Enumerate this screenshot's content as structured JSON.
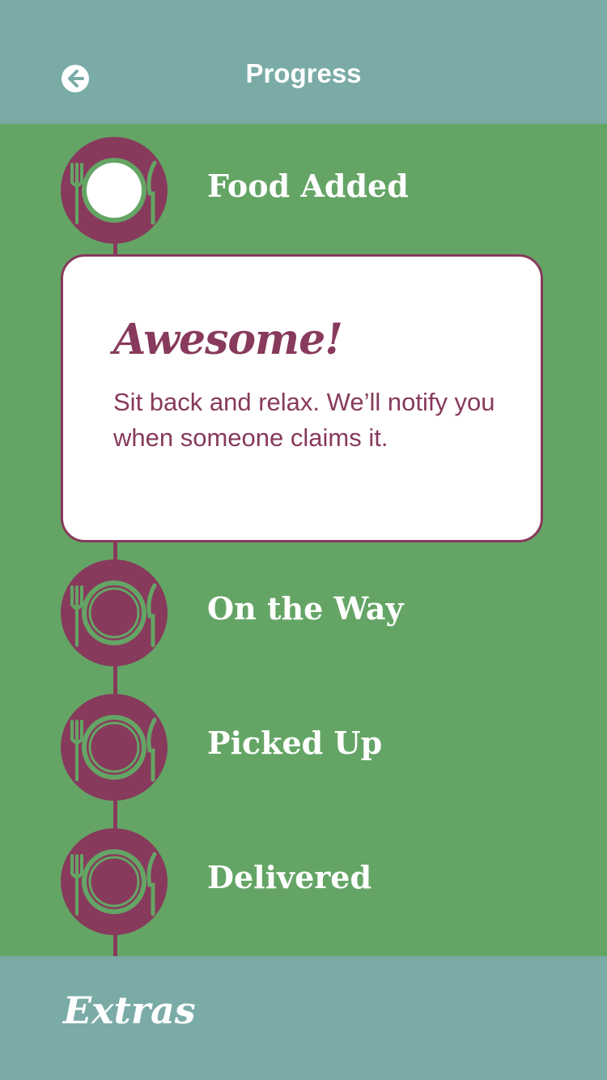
{
  "header": {
    "title": "Progress",
    "back_icon": "back-arrow-icon"
  },
  "steps": [
    {
      "label": "Food Added",
      "icon": "plate-cutlery-icon",
      "status": "complete"
    },
    {
      "label": "On the Way",
      "icon": "plate-cutlery-icon",
      "status": "pending"
    },
    {
      "label": "Picked Up",
      "icon": "plate-cutlery-icon",
      "status": "pending"
    },
    {
      "label": "Delivered",
      "icon": "plate-cutlery-icon",
      "status": "pending"
    }
  ],
  "card": {
    "title": "Awesome!",
    "body": "Sit back and relax. We’ll notify you when someone claims it."
  },
  "footer": {
    "label": "Extras"
  },
  "colors": {
    "header_bg": "#7aaba7",
    "main_bg": "#64a565",
    "accent": "#873a5c",
    "card_bg": "#ffffff",
    "text_light": "#ffffff"
  }
}
